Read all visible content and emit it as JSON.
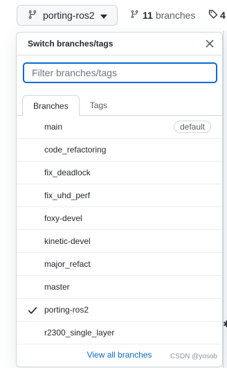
{
  "top": {
    "branch_button_label": "porting-ros2",
    "branch_count": "11",
    "branches_label": "branches",
    "tags_count_partial": "4"
  },
  "dropdown": {
    "title": "Switch branches/tags",
    "filter_placeholder": "Filter branches/tags",
    "filter_value": "",
    "tabs": [
      {
        "label": "Branches",
        "active": true
      },
      {
        "label": "Tags",
        "active": false
      }
    ],
    "items": [
      {
        "name": "main",
        "badge": "default",
        "checked": false
      },
      {
        "name": "code_refactoring",
        "checked": false
      },
      {
        "name": "fix_deadlock",
        "checked": false
      },
      {
        "name": "fix_uhd_perf",
        "checked": false
      },
      {
        "name": "foxy-devel",
        "checked": false
      },
      {
        "name": "kinetic-devel",
        "checked": false
      },
      {
        "name": "major_refact",
        "checked": false
      },
      {
        "name": "master",
        "checked": false
      },
      {
        "name": "porting-ros2",
        "checked": true
      },
      {
        "name": "r2300_single_layer",
        "checked": false
      }
    ],
    "view_all_label": "View all branches"
  },
  "watermark": "CSDN @yosob",
  "colors": {
    "accent": "#0969da",
    "border": "#d0d7de",
    "text": "#24292f",
    "muted": "#57606a"
  }
}
